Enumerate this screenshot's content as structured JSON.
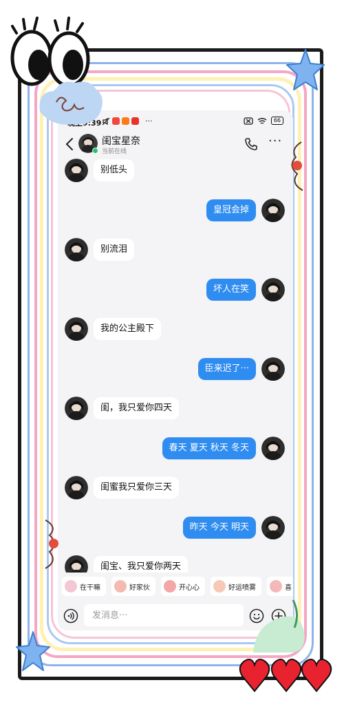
{
  "status_bar": {
    "time": "晚上9:39",
    "extra": "···",
    "battery": "66"
  },
  "header": {
    "back_icon": "chevron-left-icon",
    "contact_name": "闺宝星奈",
    "contact_status": "当前在线",
    "call_icon": "phone-icon",
    "more_label": "···"
  },
  "messages": [
    {
      "side": "in",
      "text": "别低头"
    },
    {
      "side": "out",
      "text": "皇冠会掉"
    },
    {
      "side": "in",
      "text": "别流泪"
    },
    {
      "side": "out",
      "text": "坏人在笑"
    },
    {
      "side": "in",
      "text": "我的公主殿下"
    },
    {
      "side": "out",
      "text": "臣来迟了···"
    },
    {
      "side": "in",
      "text": "闺，我只爱你四天"
    },
    {
      "side": "out",
      "text": "春天 夏天 秋天 冬天"
    },
    {
      "side": "in",
      "text": "闺蜜我只爱你三天"
    },
    {
      "side": "out",
      "text": "昨天 今天 明天"
    },
    {
      "side": "in",
      "text": "闺宝、我只爱你两天"
    }
  ],
  "quick_replies": [
    {
      "label": "在干嘛"
    },
    {
      "label": "好家伙"
    },
    {
      "label": "开心心"
    },
    {
      "label": "好运喷雾"
    },
    {
      "label": "喜"
    }
  ],
  "input": {
    "placeholder": "发消息···"
  },
  "colors": {
    "accent_blue": "#2f8cf0",
    "online_green": "#1ec76b",
    "background": "#f4f4f6"
  }
}
